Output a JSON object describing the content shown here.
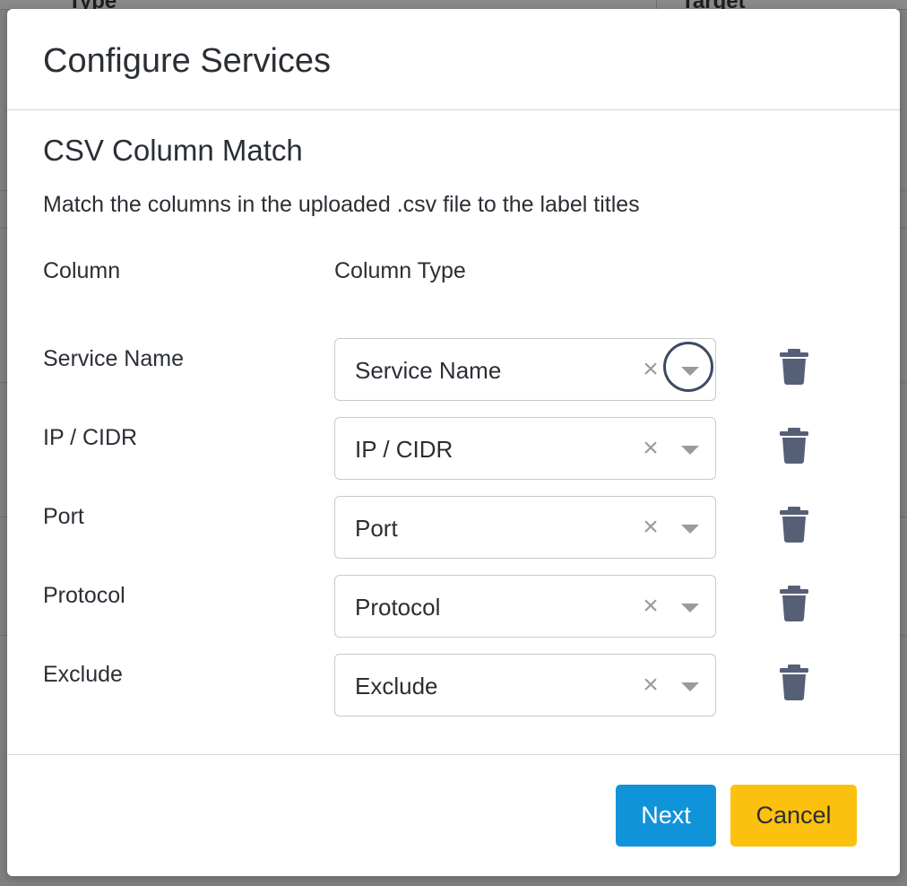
{
  "background": {
    "column_labels": [
      "Type",
      "Target"
    ]
  },
  "modal": {
    "title": "Configure Services",
    "section_title": "CSV Column Match",
    "description": "Match the columns in the uploaded .csv file to the label titles",
    "column_header": "Column",
    "column_type_header": "Column Type",
    "rows": [
      {
        "label": "Service Name",
        "selected": "Service Name"
      },
      {
        "label": "IP / CIDR",
        "selected": "IP / CIDR"
      },
      {
        "label": "Port",
        "selected": "Port"
      },
      {
        "label": "Protocol",
        "selected": "Protocol"
      },
      {
        "label": "Exclude",
        "selected": "Exclude"
      }
    ],
    "clear_glyph": "×",
    "buttons": {
      "next": "Next",
      "cancel": "Cancel"
    }
  },
  "colors": {
    "next_button": "#1193d9",
    "cancel_button": "#fcc10f",
    "trash_icon": "#556077",
    "focus_ring": "#3d4a63"
  },
  "icons": {
    "delete": "trash-icon",
    "clear": "close-icon",
    "dropdown": "chevron-down-icon"
  }
}
